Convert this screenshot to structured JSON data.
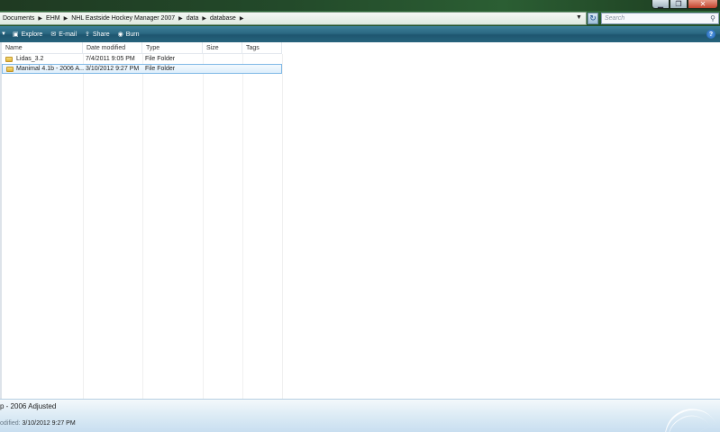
{
  "address": {
    "breadcrumbs": [
      "Documents",
      "EHM",
      "NHL Eastside Hockey Manager 2007",
      "data",
      "database"
    ],
    "search_placeholder": "Search"
  },
  "commandbar": {
    "items": [
      {
        "label": "Explore",
        "icon": "explore-icon"
      },
      {
        "label": "E-mail",
        "icon": "email-icon"
      },
      {
        "label": "Share",
        "icon": "share-icon"
      },
      {
        "label": "Burn",
        "icon": "burn-icon"
      }
    ]
  },
  "columns": [
    "Name",
    "Date modified",
    "Type",
    "Size",
    "Tags"
  ],
  "files": [
    {
      "name": "Lidas_3.2",
      "date": "7/4/2011 9:05 PM",
      "type": "File Folder",
      "size": "",
      "tags": ""
    },
    {
      "name": "Manimal 4.1b - 2006 A...",
      "date": "3/10/2012 9:27 PM",
      "type": "File Folder",
      "size": "",
      "tags": "",
      "selected": true
    }
  ],
  "details": {
    "title": "p - 2006 Adjusted",
    "modified_label": "odified:",
    "modified_value": "3/10/2012 9:27 PM"
  },
  "colors": {
    "commandbar": "#2b6882",
    "selection_border": "#7fb8e6",
    "titlebar": "#234a2a"
  }
}
